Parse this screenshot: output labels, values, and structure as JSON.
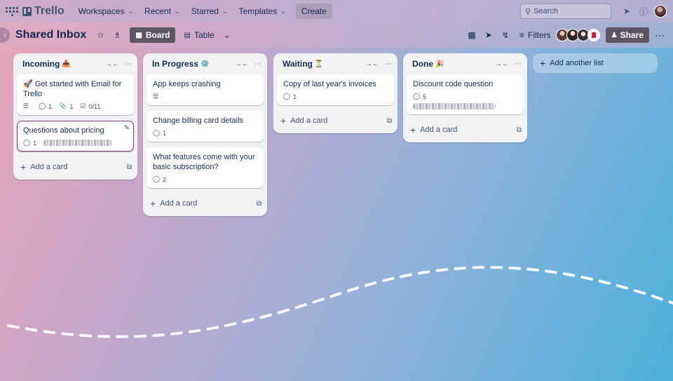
{
  "app": {
    "name": "Trello"
  },
  "topnav": {
    "menus": [
      {
        "label": "Workspaces"
      },
      {
        "label": "Recent"
      },
      {
        "label": "Starred"
      },
      {
        "label": "Templates"
      }
    ],
    "create_label": "Create",
    "search_placeholder": "Search"
  },
  "board": {
    "title": "Shared Inbox",
    "views": {
      "board": "Board",
      "table": "Table"
    },
    "filters_label": "Filters",
    "share_label": "Share"
  },
  "lists": [
    {
      "title": "Incoming",
      "emoji": "📥",
      "cards": [
        {
          "title": "🚀 Get started with Email for Trello",
          "comments": "1",
          "attachments": "1",
          "checklist": "0/11"
        },
        {
          "title": "Questions about pricing",
          "comments": "1"
        }
      ],
      "add_card": "Add a card"
    },
    {
      "title": "In Progress",
      "emoji": "⚙️",
      "cards": [
        {
          "title": "App keeps crashing"
        },
        {
          "title": "Change billing card details",
          "comments": "1"
        },
        {
          "title": "What features come with your basic subscription?",
          "comments": "2"
        }
      ],
      "add_card": "Add a card"
    },
    {
      "title": "Waiting",
      "emoji": "⏳",
      "cards": [
        {
          "title": "Copy of last year's invoices",
          "comments": "1"
        }
      ],
      "add_card": "Add a card"
    },
    {
      "title": "Done",
      "emoji": "🎉",
      "cards": [
        {
          "title": "Discount code question",
          "comments": "5"
        }
      ],
      "add_card": "Add a card"
    }
  ],
  "add_list_label": "Add another list",
  "colors": {
    "accent": "#5e5564",
    "list_bg": "#f1f2f4",
    "focus_border": "#8a3f74"
  }
}
